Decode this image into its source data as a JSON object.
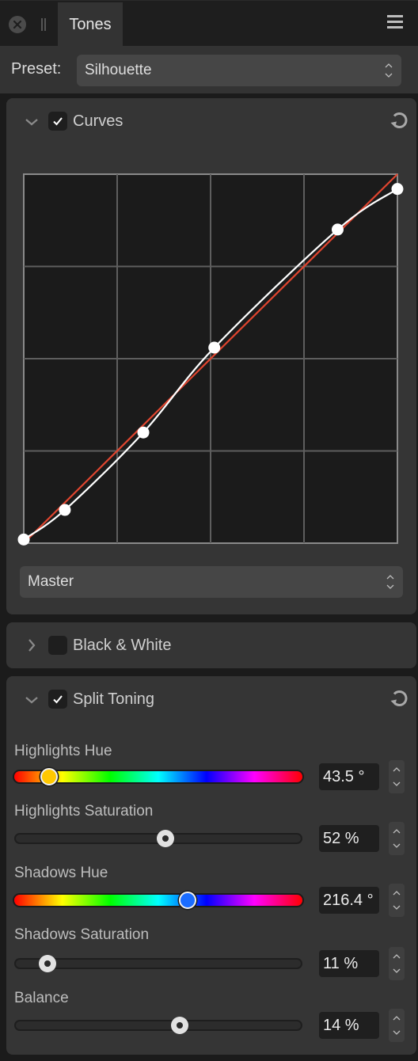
{
  "titlebar": {
    "tab_label": "Tones",
    "close_icon": "close-circle-icon",
    "menu_icon": "hamburger-menu-icon"
  },
  "preset": {
    "label": "Preset:",
    "value": "Silhouette"
  },
  "sections": {
    "curves": {
      "title": "Curves",
      "expanded": true,
      "enabled": true,
      "channel": "Master",
      "curve_color": "#ffffff",
      "reference_color": "#e0452f",
      "points": [
        {
          "x": 0.0,
          "y": 0.01
        },
        {
          "x": 0.11,
          "y": 0.09
        },
        {
          "x": 0.32,
          "y": 0.3
        },
        {
          "x": 0.51,
          "y": 0.53
        },
        {
          "x": 0.84,
          "y": 0.85
        },
        {
          "x": 1.0,
          "y": 0.96
        }
      ]
    },
    "black_white": {
      "title": "Black & White",
      "expanded": false,
      "enabled": false
    },
    "split_toning": {
      "title": "Split Toning",
      "expanded": true,
      "enabled": true,
      "sliders": [
        {
          "label": "Highlights Hue",
          "type": "hue",
          "value_text": "43.5 °",
          "value": 43.5,
          "min": 0,
          "max": 360,
          "knob_color": "#ffc800"
        },
        {
          "label": "Highlights Saturation",
          "type": "plain",
          "value_text": "52 %",
          "value": 52,
          "min": 0,
          "max": 100
        },
        {
          "label": "Shadows Hue",
          "type": "hue",
          "value_text": "216.4 °",
          "value": 216.4,
          "min": 0,
          "max": 360,
          "knob_color": "#1a6cff"
        },
        {
          "label": "Shadows Saturation",
          "type": "plain",
          "value_text": "11 %",
          "value": 11,
          "min": 0,
          "max": 100
        },
        {
          "label": "Balance",
          "type": "plain",
          "value_text": "14 %",
          "value": 14,
          "min": -100,
          "max": 100
        }
      ]
    }
  }
}
